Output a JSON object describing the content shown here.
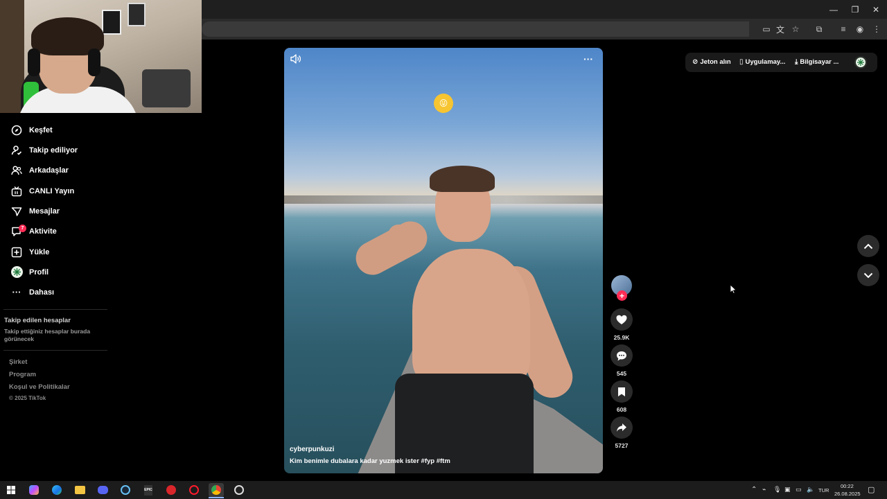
{
  "sidebar": {
    "items": [
      {
        "label": "Keşfet"
      },
      {
        "label": "Takip ediliyor"
      },
      {
        "label": "Arkadaşlar"
      },
      {
        "label": "CANLI Yayın"
      },
      {
        "label": "Mesajlar"
      },
      {
        "label": "Aktivite",
        "badge": "7"
      },
      {
        "label": "Yükle"
      },
      {
        "label": "Profil"
      },
      {
        "label": "Dahası"
      }
    ],
    "following_title": "Takip edilen hesaplar",
    "following_sub": "Takip ettiğiniz hesaplar burada görünecek",
    "footer": [
      "Şirket",
      "Program",
      "Koşul ve Politikalar"
    ],
    "copyright": "© 2025 TikTok"
  },
  "video": {
    "author": "cyberpunkuzi",
    "caption": "Kim benimle dubalara kadar yuzmek ister #fyp  #ftm",
    "emoji": "😜"
  },
  "actions": {
    "likes": "25.9K",
    "comments": "545",
    "saves": "608",
    "shares": "5727"
  },
  "topbar": {
    "coins": "Jeton alın",
    "app": "Uygulamay...",
    "desktop": "Bilgisayar ..."
  },
  "tray": {
    "lang": "TUR",
    "time": "00:22",
    "date": "26.08.2025"
  },
  "colors": {
    "accent": "#fe2c55",
    "bg": "#000000"
  }
}
